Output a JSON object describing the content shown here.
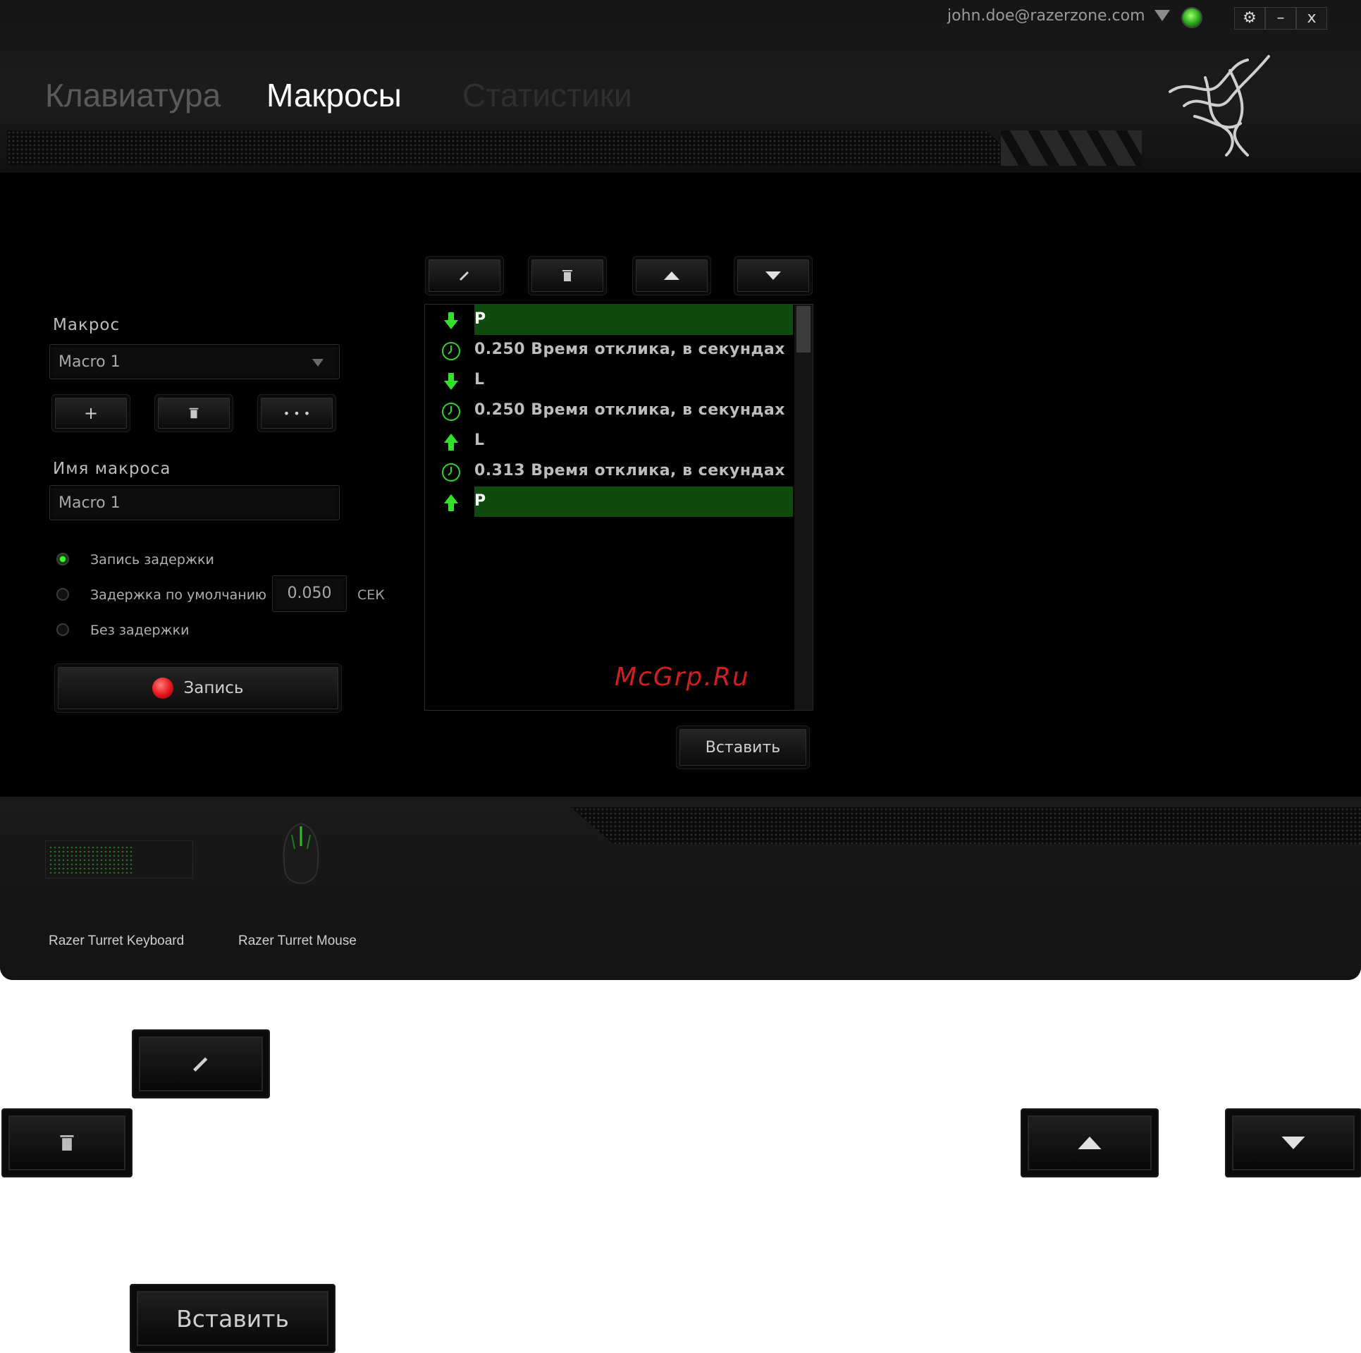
{
  "header": {
    "user_email": "john.doe@razerzone.com",
    "window_controls": [
      "⚙",
      "–",
      "x"
    ]
  },
  "tabs": [
    {
      "label": "Клавиатура",
      "active": false
    },
    {
      "label": "Макросы",
      "active": true
    },
    {
      "label": "Статистики",
      "active": false
    }
  ],
  "macro_panel": {
    "macro_label": "Макрос",
    "macro_select_value": "Macro 1",
    "add_label": "+",
    "more_label": "• • •",
    "name_label": "Имя макроса",
    "name_value": "Macro 1",
    "options": [
      {
        "label": "Запись задержки",
        "selected": true
      },
      {
        "label": "Задержка по умолчанию",
        "selected": false
      },
      {
        "label": "Без задержки",
        "selected": false
      }
    ],
    "default_delay_value": "0.050",
    "delay_unit": "СЕК",
    "record_label": "Запись"
  },
  "macro_list": {
    "rows": [
      {
        "type": "key-down",
        "text": "P",
        "selected": true
      },
      {
        "type": "delay",
        "text": "0.250 Время отклика, в секундах",
        "selected": false
      },
      {
        "type": "key-down",
        "text": "L",
        "selected": false
      },
      {
        "type": "delay",
        "text": "0.250 Время отклика, в секундах",
        "selected": false
      },
      {
        "type": "key-up",
        "text": "L",
        "selected": false
      },
      {
        "type": "delay",
        "text": "0.313 Время отклика, в секундах",
        "selected": false
      },
      {
        "type": "key-up",
        "text": "P",
        "selected": true
      }
    ],
    "insert_label": "Вставить"
  },
  "watermark": "McGrp.Ru",
  "devices": [
    {
      "label": "Razer Turret Keyboard"
    },
    {
      "label": "Razer Turret Mouse"
    }
  ],
  "legend": {
    "insert_label": "Вставить"
  },
  "colors": {
    "accent_green": "#39ff2a",
    "selection_bg": "#0f4a0f",
    "record_red": "#e3141b"
  }
}
